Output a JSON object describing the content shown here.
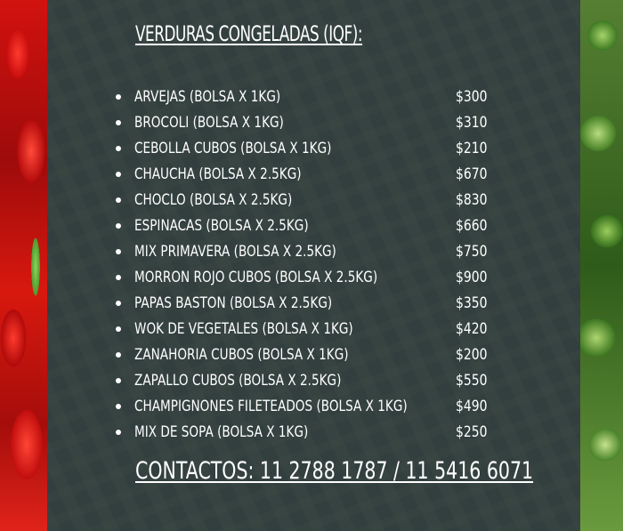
{
  "title": "VERDURAS CONGELADAS (IQF):",
  "items": [
    {
      "name": "ARVEJAS (BOLSA X 1KG)",
      "price": "$300"
    },
    {
      "name": "BROCOLI (BOLSA X 1KG)",
      "price": "$310"
    },
    {
      "name": "CEBOLLA CUBOS (BOLSA X 1KG)",
      "price": "$210"
    },
    {
      "name": "CHAUCHA (BOLSA X 2.5KG)",
      "price": "$670"
    },
    {
      "name": "CHOCLO (BOLSA X 2.5KG)",
      "price": "$830"
    },
    {
      "name": "ESPINACAS (BOLSA X 2.5KG)",
      "price": "$660"
    },
    {
      "name": "MIX PRIMAVERA (BOLSA X 2.5KG)",
      "price": "$750"
    },
    {
      "name": "MORRON ROJO CUBOS (BOLSA X 2.5KG)",
      "price": "$900"
    },
    {
      "name": "PAPAS BASTON (BOLSA X 2.5KG)",
      "price": "$350"
    },
    {
      "name": "WOK DE VEGETALES (BOLSA X 1KG)",
      "price": "$420"
    },
    {
      "name": "ZANAHORIA CUBOS (BOLSA X 1KG)",
      "price": "$200"
    },
    {
      "name": "ZAPALLO CUBOS (BOLSA X 2.5KG)",
      "price": "$550"
    },
    {
      "name": "CHAMPIGNONES FILETEADOS (BOLSA X 1KG)",
      "price": "$490"
    },
    {
      "name": "MIX DE SOPA (BOLSA X 1KG)",
      "price": "$250"
    }
  ],
  "contacts": "CONTACTOS: 11 2788 1787 / 11 5416 6071",
  "colors": {
    "text": "#ffffff",
    "panel_overlay": "#2d373c",
    "pepper_red": "#c80d0d",
    "broccoli_green": "#477f26"
  }
}
